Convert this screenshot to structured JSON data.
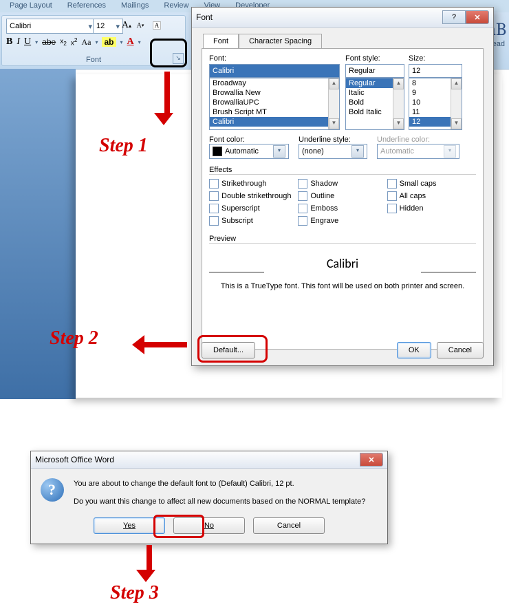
{
  "ribbon": {
    "tabs": [
      "Page Layout",
      "References",
      "Mailings",
      "Review",
      "View",
      "Developer"
    ],
    "font_name": "Calibri",
    "font_size": "12",
    "group_label": "Font",
    "style_preview": "AaB",
    "style_head": "Head"
  },
  "steps": {
    "s1": "Step 1",
    "s2": "Step 2",
    "s3": "Step 3"
  },
  "dialog": {
    "title": "Font",
    "tabs": {
      "font": "Font",
      "spacing": "Character Spacing"
    },
    "labels": {
      "font": "Font:",
      "style": "Font style:",
      "size": "Size:",
      "font_color": "Font color:",
      "underline_style": "Underline style:",
      "underline_color": "Underline color:"
    },
    "values": {
      "font": "Calibri",
      "style": "Regular",
      "size": "12",
      "font_color": "Automatic",
      "underline_style": "(none)",
      "underline_color": "Automatic"
    },
    "font_list": [
      "Broadway",
      "Browallia New",
      "BrowalliaUPC",
      "Brush Script MT",
      "Calibri"
    ],
    "style_list": [
      "Regular",
      "Italic",
      "Bold",
      "Bold Italic"
    ],
    "size_list": [
      "8",
      "9",
      "10",
      "11",
      "12"
    ],
    "effects": {
      "header": "Effects",
      "col1": [
        "Strikethrough",
        "Double strikethrough",
        "Superscript",
        "Subscript"
      ],
      "col2": [
        "Shadow",
        "Outline",
        "Emboss",
        "Engrave"
      ],
      "col3": [
        "Small caps",
        "All caps",
        "Hidden"
      ]
    },
    "preview": {
      "header": "Preview",
      "sample": "Calibri",
      "note": "This is a TrueType font. This font will be used on both printer and screen."
    },
    "buttons": {
      "default": "Default...",
      "ok": "OK",
      "cancel": "Cancel"
    }
  },
  "msgbox": {
    "title": "Microsoft Office Word",
    "line1": "You are about to change the default font to (Default) Calibri, 12 pt.",
    "line2": "Do you want this change to affect all new documents based on the NORMAL template?",
    "yes": "Yes",
    "no": "No",
    "cancel": "Cancel"
  }
}
